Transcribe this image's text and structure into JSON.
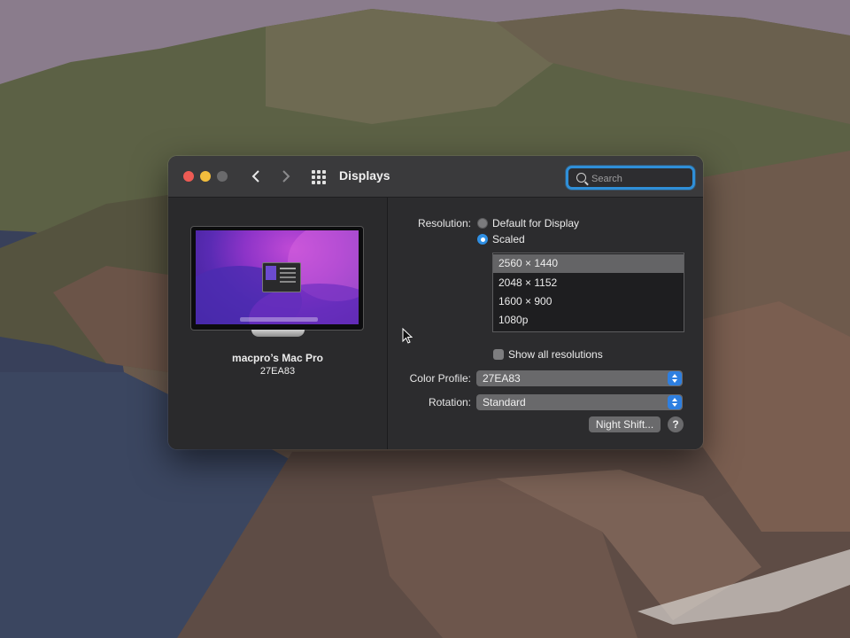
{
  "window": {
    "title": "Displays",
    "nav_back_icon": "chevron-left-icon",
    "nav_forward_icon": "chevron-right-icon",
    "grid_icon": "grid-icon"
  },
  "search": {
    "placeholder": "Search",
    "value": ""
  },
  "display": {
    "name": "macpro’s Mac Pro",
    "model": "27EA83"
  },
  "resolution": {
    "label": "Resolution:",
    "options": [
      {
        "label": "Default for Display",
        "selected": false
      },
      {
        "label": "Scaled",
        "selected": true
      }
    ],
    "scaled_list": [
      "2560 × 1440",
      "2048 × 1152",
      "1600 × 900",
      "1080p"
    ],
    "selected_index": 0
  },
  "show_all": {
    "label": "Show all resolutions",
    "checked": false
  },
  "color_profile": {
    "label": "Color Profile:",
    "value": "27EA83"
  },
  "rotation": {
    "label": "Rotation:",
    "value": "Standard"
  },
  "night_shift_button": "Night Shift...",
  "help_button": "?",
  "colors": {
    "accent": "#2f8fe3",
    "window_bg": "#2c2c2e",
    "close": "#ee5b54",
    "minimize": "#f2bd3d"
  }
}
